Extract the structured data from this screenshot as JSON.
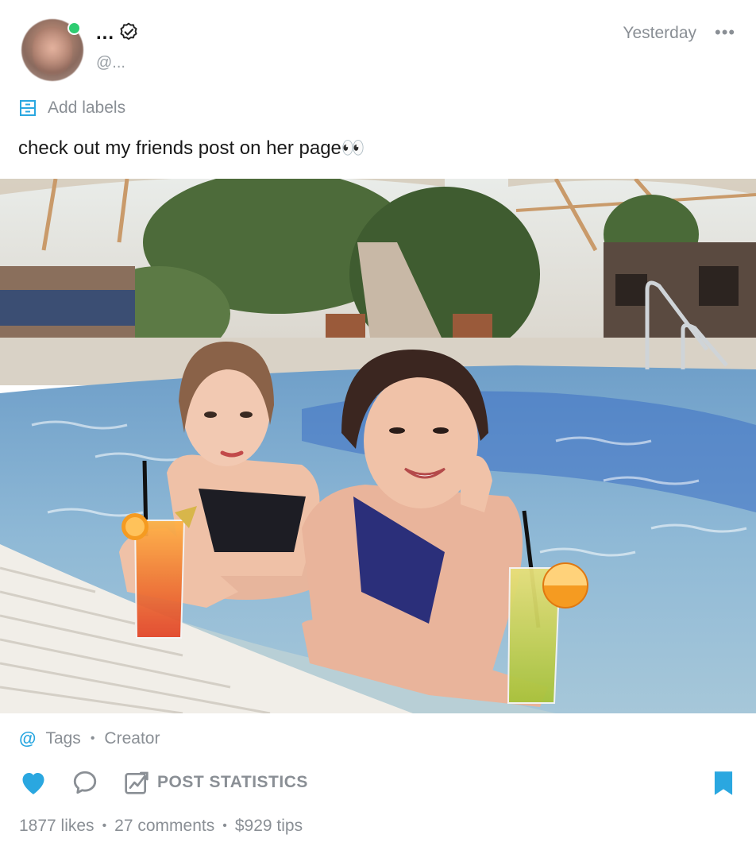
{
  "post": {
    "author": {
      "display_name": "...",
      "username": "@...",
      "online": true,
      "verified": true
    },
    "timestamp": "Yesterday",
    "more_icon": "more-horizontal-icon",
    "labels_action": "Add labels",
    "text": "check out my friends post on her page👀",
    "image_icon": "post-photo",
    "tags_label": "Tags",
    "creator_label": "Creator",
    "actions": {
      "like_icon": "heart-icon",
      "comment_icon": "comment-icon",
      "stats_label": "POST STATISTICS",
      "bookmark_icon": "bookmark-icon"
    },
    "stats": {
      "likes": "1877 likes",
      "comments": "27 comments",
      "tips": "$929 tips"
    }
  },
  "colors": {
    "accent": "#2aa7e0",
    "muted_text": "#8a8f95",
    "online": "#2ecc71"
  }
}
